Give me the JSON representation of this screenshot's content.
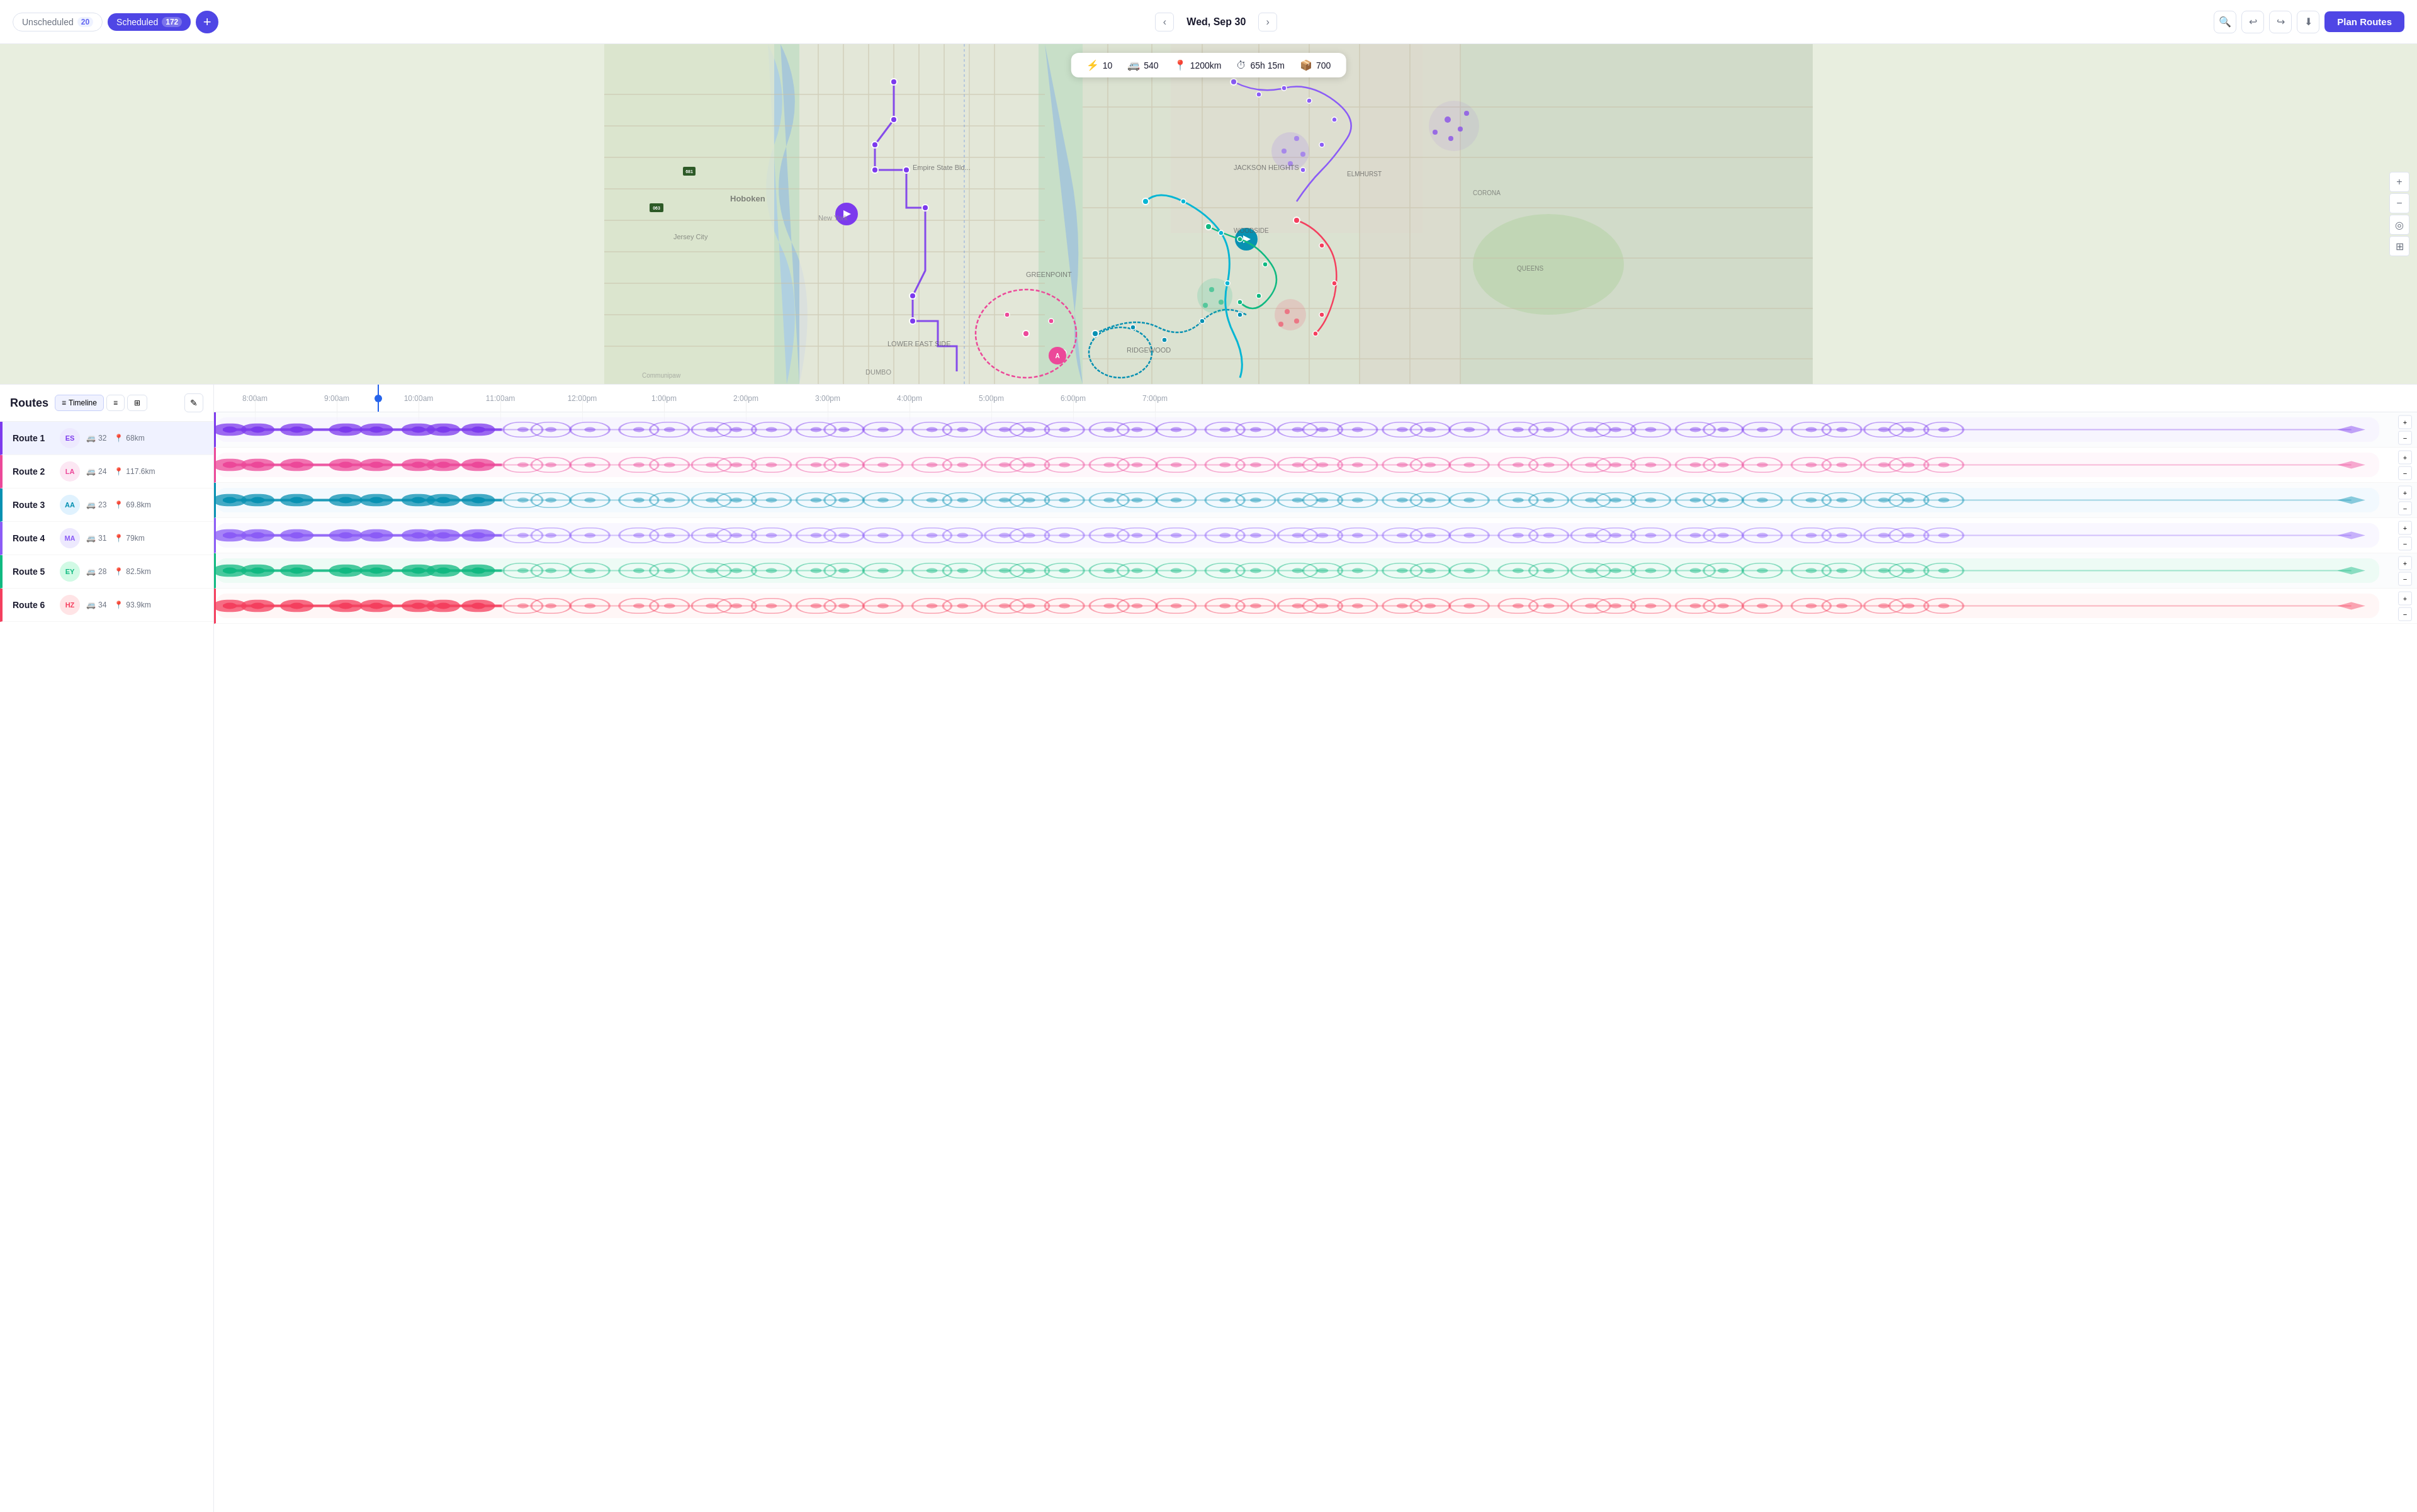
{
  "header": {
    "unscheduled_label": "Unscheduled",
    "unscheduled_count": "20",
    "scheduled_label": "Scheduled",
    "scheduled_count": "172",
    "add_button": "+",
    "date": "Wed, Sep 30",
    "nav_prev": "‹",
    "nav_next": "›",
    "plan_routes_label": "Plan Routes"
  },
  "map_info": {
    "routes_icon": "⚡",
    "routes_count": "10",
    "stops_icon": "🚌",
    "stops_count": "540",
    "distance_icon": "📍",
    "distance": "1200km",
    "time_icon": "⏱",
    "time": "65h 15m",
    "packages_icon": "📦",
    "packages": "700"
  },
  "routes_panel": {
    "title": "Routes",
    "view_timeline": "Timeline",
    "view_list": "≡",
    "view_grid": "⊞",
    "routes": [
      {
        "name": "Route 1",
        "color": "#7c3aed",
        "avatar_text": "ES",
        "avatar_bg": "#ede9fe",
        "avatar_color": "#7c3aed",
        "stops": "32",
        "distance": "68km"
      },
      {
        "name": "Route 2",
        "color": "#ec4899",
        "avatar_text": "LA",
        "avatar_bg": "#fce7f3",
        "avatar_color": "#ec4899",
        "stops": "24",
        "distance": "117.6km"
      },
      {
        "name": "Route 3",
        "color": "#0891b2",
        "avatar_text": "AA",
        "avatar_bg": "#e0f2fe",
        "avatar_color": "#0891b2",
        "stops": "23",
        "distance": "69.8km"
      },
      {
        "name": "Route 4",
        "color": "#8b5cf6",
        "avatar_text": "MA",
        "avatar_bg": "#ede9fe",
        "avatar_color": "#8b5cf6",
        "stops": "31",
        "distance": "79km"
      },
      {
        "name": "Route 5",
        "color": "#10b981",
        "avatar_text": "EY",
        "avatar_bg": "#d1fae5",
        "avatar_color": "#10b981",
        "stops": "28",
        "distance": "82.5km"
      },
      {
        "name": "Route 6",
        "color": "#f43f5e",
        "avatar_text": "HZ",
        "avatar_bg": "#ffe4e6",
        "avatar_color": "#f43f5e",
        "stops": "34",
        "distance": "93.9km"
      }
    ]
  },
  "timeline": {
    "times": [
      "8:00am",
      "9:00am",
      "10:00am",
      "11:00am",
      "12:00pm",
      "1:00pm",
      "2:00pm",
      "3:00pm",
      "4:00pm",
      "5:00pm",
      "6:00pm",
      "7:00pm"
    ],
    "current_time": "10:00am"
  }
}
